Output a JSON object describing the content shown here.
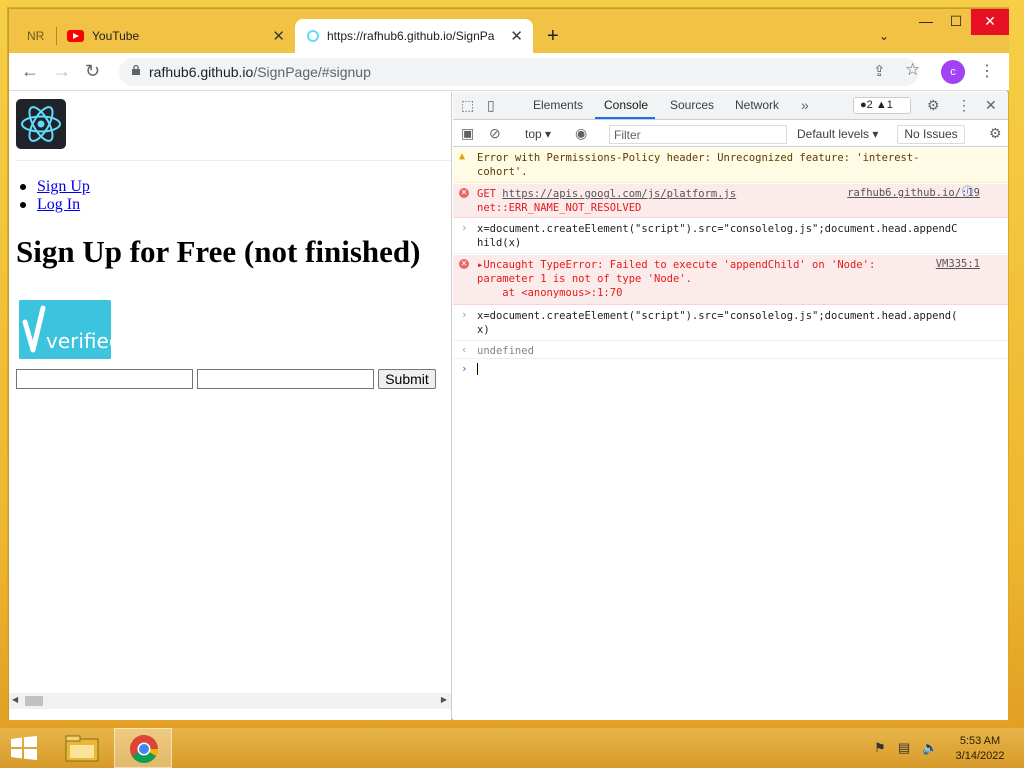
{
  "browser": {
    "tabs": [
      {
        "label": "NR"
      },
      {
        "label": "YouTube"
      },
      {
        "label": "https://rafhub6.github.io/SignPage/#signup"
      }
    ],
    "new_tab_symbol": "+",
    "url_host": "rafhub6.github.io",
    "url_path": "/SignPage/#signup",
    "avatar_letter": "c"
  },
  "page": {
    "links": [
      "Sign Up",
      "Log In"
    ],
    "heading": "Sign Up for Free (not finished)",
    "submit_label": "Submit",
    "verified_text": "verified"
  },
  "devtools": {
    "tabs": [
      "Elements",
      "Console",
      "Sources",
      "Network"
    ],
    "active_tab": "Console",
    "error_count": "2",
    "warning_count": "1",
    "context": "top",
    "filter_placeholder": "Filter",
    "levels_label": "Default levels",
    "issues_label": "No Issues",
    "messages": [
      {
        "type": "warning",
        "line1": "Error with Permissions-Policy header: Unrecognized feature: 'interest-",
        "line2": "cohort'."
      },
      {
        "type": "error",
        "line1_prefix": "GET ",
        "line1_link": "https://apis.googl.com/js/platform.js",
        "line2": "net::ERR_NAME_NOT_RESOLVED",
        "source": "rafhub6.github.io/:19"
      },
      {
        "type": "input",
        "line1": "x=document.createElement(\"script\").src=\"consolelog.js\";document.head.appendC",
        "line2": "hild(x)"
      },
      {
        "type": "error",
        "line1": "Uncaught TypeError: Failed to execute 'appendChild' on 'Node':",
        "line2": "parameter 1 is not of type 'Node'.",
        "line3": "    at <anonymous>:1:70",
        "source": "VM335:1"
      },
      {
        "type": "input",
        "line1": "x=document.createElement(\"script\").src=\"consolelog.js\";document.head.append(",
        "line2": "x)"
      },
      {
        "type": "return",
        "line1": "undefined"
      }
    ]
  },
  "taskbar": {
    "time": "5:53 AM",
    "date": "3/14/2022"
  },
  "colors": {
    "accent": "#1a73e8",
    "error": "#e41c1c",
    "warning_bg": "#fffbe5",
    "error_bg": "#fcebeb",
    "titlebar": "#f2c244"
  }
}
